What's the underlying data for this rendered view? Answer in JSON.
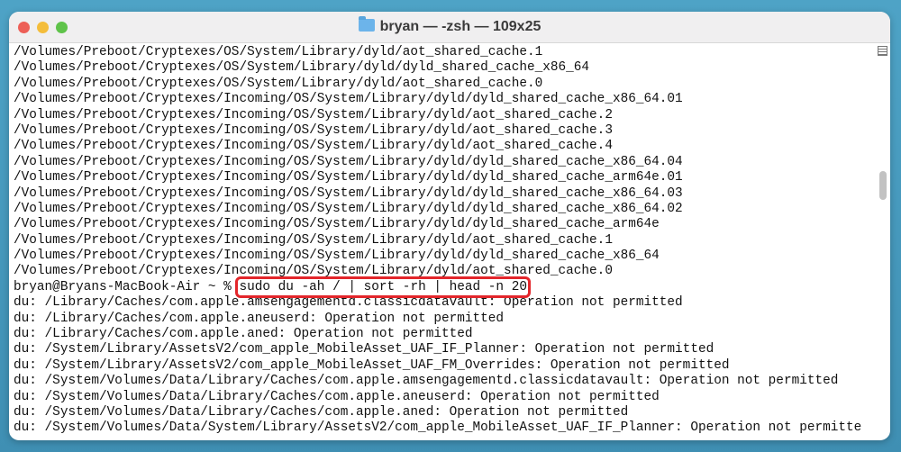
{
  "window": {
    "title": "bryan — -zsh — 109x25",
    "colors": {
      "close": "#ed5f57",
      "minimize": "#f4bd3b",
      "zoom": "#5fc34a",
      "highlight": "#e3262b"
    }
  },
  "terminal": {
    "lines_before": [
      "/Volumes/Preboot/Cryptexes/OS/System/Library/dyld/aot_shared_cache.1",
      "/Volumes/Preboot/Cryptexes/OS/System/Library/dyld/dyld_shared_cache_x86_64",
      "/Volumes/Preboot/Cryptexes/OS/System/Library/dyld/aot_shared_cache.0",
      "/Volumes/Preboot/Cryptexes/Incoming/OS/System/Library/dyld/dyld_shared_cache_x86_64.01",
      "/Volumes/Preboot/Cryptexes/Incoming/OS/System/Library/dyld/aot_shared_cache.2",
      "/Volumes/Preboot/Cryptexes/Incoming/OS/System/Library/dyld/aot_shared_cache.3",
      "/Volumes/Preboot/Cryptexes/Incoming/OS/System/Library/dyld/aot_shared_cache.4",
      "/Volumes/Preboot/Cryptexes/Incoming/OS/System/Library/dyld/dyld_shared_cache_x86_64.04",
      "/Volumes/Preboot/Cryptexes/Incoming/OS/System/Library/dyld/dyld_shared_cache_arm64e.01",
      "/Volumes/Preboot/Cryptexes/Incoming/OS/System/Library/dyld/dyld_shared_cache_x86_64.03",
      "/Volumes/Preboot/Cryptexes/Incoming/OS/System/Library/dyld/dyld_shared_cache_x86_64.02",
      "/Volumes/Preboot/Cryptexes/Incoming/OS/System/Library/dyld/dyld_shared_cache_arm64e",
      "/Volumes/Preboot/Cryptexes/Incoming/OS/System/Library/dyld/aot_shared_cache.1",
      "/Volumes/Preboot/Cryptexes/Incoming/OS/System/Library/dyld/dyld_shared_cache_x86_64",
      "/Volumes/Preboot/Cryptexes/Incoming/OS/System/Library/dyld/aot_shared_cache.0"
    ],
    "prompt": "bryan@Bryans-MacBook-Air ~ % ",
    "command": "sudo du -ah / | sort -rh | head -n 20",
    "lines_after": [
      "du: /Library/Caches/com.apple.amsengagementd.classicdatavault: Operation not permitted",
      "du: /Library/Caches/com.apple.aneuserd: Operation not permitted",
      "du: /Library/Caches/com.apple.aned: Operation not permitted",
      "du: /System/Library/AssetsV2/com_apple_MobileAsset_UAF_IF_Planner: Operation not permitted",
      "du: /System/Library/AssetsV2/com_apple_MobileAsset_UAF_FM_Overrides: Operation not permitted",
      "du: /System/Volumes/Data/Library/Caches/com.apple.amsengagementd.classicdatavault: Operation not permitted",
      "du: /System/Volumes/Data/Library/Caches/com.apple.aneuserd: Operation not permitted",
      "du: /System/Volumes/Data/Library/Caches/com.apple.aned: Operation not permitted",
      "du: /System/Volumes/Data/System/Library/AssetsV2/com_apple_MobileAsset_UAF_IF_Planner: Operation not permitte"
    ]
  }
}
